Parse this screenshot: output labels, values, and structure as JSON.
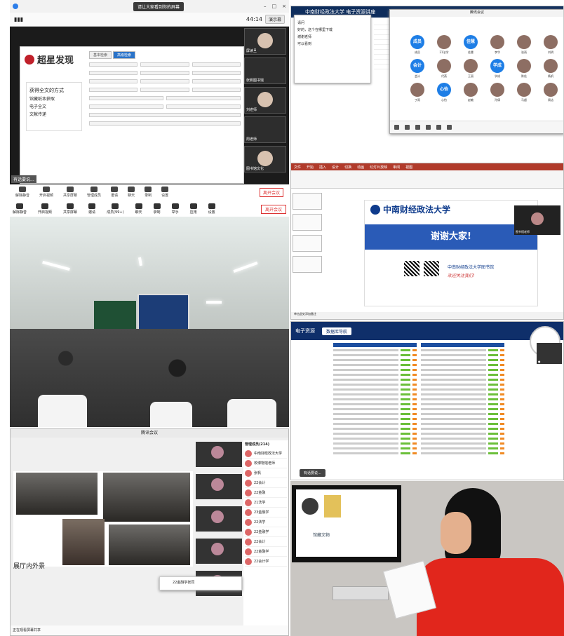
{
  "tile1": {
    "window_title": "请让大家看到你的屏幕",
    "share_label": "演示幕",
    "share_count": "44:14",
    "logo_text": "超星发现",
    "menu_title": "获得全文的方式",
    "menu_items": [
      "馆藏纸本获取",
      "电子全文",
      "文献传递"
    ],
    "form_tabs": [
      "基本检索",
      "高级检索"
    ],
    "participants": [
      "屏读旦",
      "张帆图书馆",
      "刘老师",
      "周老师",
      "图书馆文化"
    ],
    "toolbar": [
      "解除静音",
      "开启视频",
      "共享屏幕",
      "管理成员",
      "邀请",
      "聊天",
      "录制",
      "设置"
    ],
    "end_label": "离开会议",
    "typing_hint": "有话要说..."
  },
  "tile2": {
    "banner": "中南财经政法大学 电子资源讲座",
    "chat_lines": [
      "请问",
      "好的，这个在哪里下载",
      "谢谢老师",
      "可以看到"
    ],
    "meeting_title": "腾讯会议",
    "participants": [
      {
        "initials": "成员",
        "name": "成员"
      },
      {
        "initials": "",
        "name": "21法学"
      },
      {
        "initials": "佳慧",
        "name": "佳慧"
      },
      {
        "initials": "",
        "name": "李华"
      },
      {
        "initials": "",
        "name": "张雨"
      },
      {
        "initials": "",
        "name": "刘明"
      },
      {
        "initials": "会计",
        "name": "会计"
      },
      {
        "initials": "",
        "name": "代燕"
      },
      {
        "initials": "",
        "name": "王丽"
      },
      {
        "initials": "学成",
        "name": "学成"
      },
      {
        "initials": "",
        "name": "陈佳"
      },
      {
        "initials": "",
        "name": "杨帆"
      },
      {
        "initials": "",
        "name": "丁雨"
      },
      {
        "initials": "心怡",
        "name": "心怡"
      },
      {
        "initials": "",
        "name": "赵敏"
      },
      {
        "initials": "",
        "name": "孙倩"
      },
      {
        "initials": "",
        "name": "马超"
      },
      {
        "initials": "",
        "name": "周洁"
      }
    ]
  },
  "tile3": {
    "toolbar": [
      "解除静音",
      "开启视频",
      "共享屏幕",
      "邀请",
      "成员(99+)",
      "聊天",
      "录制",
      "举手",
      "应用",
      "设置"
    ],
    "end_label": "离开会议"
  },
  "tile4": {
    "logo": "中南财经政法大学",
    "thanks": "谢谢大家!",
    "library": "中南财经政法大学图书馆",
    "slogan": "欢迎关注我们!",
    "qr_labels": [
      "图书馆微信",
      "图书馆微博"
    ],
    "cam_name": "图书馆老师",
    "footer": "单击此处添加备注"
  },
  "tile5": {
    "header": "电子资源",
    "tab": "数据库导航",
    "typing_hint": "有话要说..."
  },
  "tile6": {
    "title": "腾讯会议",
    "screen_caption": "展厅内外景",
    "members_header": "管理成员(214)",
    "members": [
      "中南财经政法大学",
      "校博物馆老师",
      "张帆",
      "22会计",
      "22金融",
      "21法学",
      "23金融学",
      "22法学",
      "22金融学",
      "22会计",
      "22金融学",
      "22会计学"
    ],
    "popup": "22金融学张同",
    "status": "正在观看屏幕共享"
  },
  "tile7": {
    "screen_title": "馆藏文物"
  }
}
